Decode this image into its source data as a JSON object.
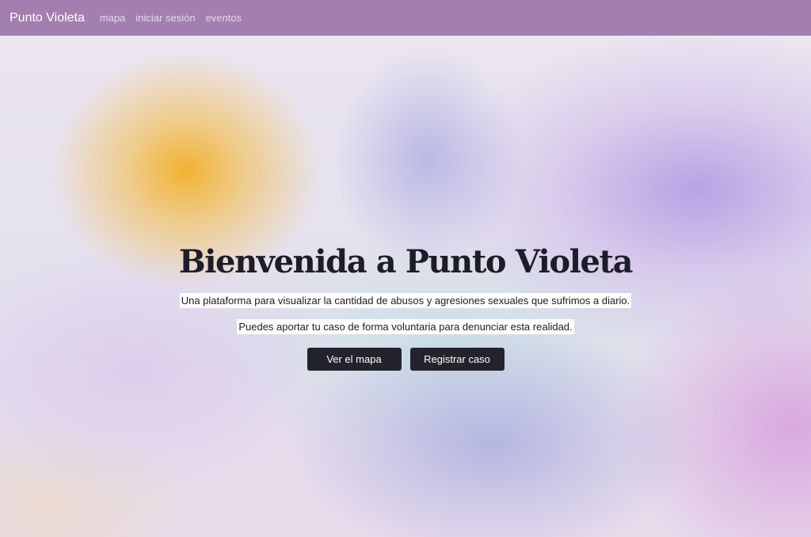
{
  "navbar": {
    "brand": "Punto Violeta",
    "links": [
      "mapa",
      "iniciar sesión",
      "eventos"
    ]
  },
  "hero": {
    "title": "Bienvenida a Punto Violeta",
    "paragraphs": [
      "Una plataforma para visualizar la cantidad de abusos y agresiones sexuales que sufrimos a diario.",
      "Puedes aportar tu caso de forma voluntaria para denunciar esta realidad."
    ],
    "buttons": [
      "Ver el mapa",
      "Registrar caso"
    ]
  },
  "colors": {
    "navbar_background": "#a37fb0",
    "button_background": "#23232b",
    "title_text": "#1d1d27",
    "accent_orange": "#f2b028",
    "accent_lilac": "#aa8ce1"
  }
}
